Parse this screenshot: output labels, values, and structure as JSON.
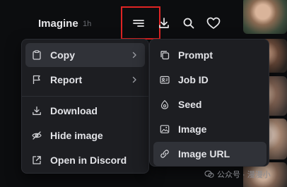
{
  "header": {
    "title": "Imagine",
    "time": "1h",
    "highlight_color": "#e02424"
  },
  "icons": {
    "menu": "menu-lines-icon",
    "download": "download-icon",
    "search": "search-icon",
    "like": "heart-icon"
  },
  "main_menu": {
    "items": [
      {
        "label": "Copy",
        "icon": "clipboard-icon",
        "submenu": true,
        "active": true
      },
      {
        "label": "Report",
        "icon": "flag-icon",
        "submenu": true
      },
      {
        "label": "Download",
        "icon": "download-icon"
      },
      {
        "label": "Hide image",
        "icon": "eye-off-icon"
      },
      {
        "label": "Open in Discord",
        "icon": "external-link-icon"
      }
    ]
  },
  "copy_submenu": {
    "items": [
      {
        "label": "Prompt",
        "icon": "copy-icon"
      },
      {
        "label": "Job ID",
        "icon": "id-card-icon"
      },
      {
        "label": "Seed",
        "icon": "seed-icon"
      },
      {
        "label": "Image",
        "icon": "image-icon"
      },
      {
        "label": "Image URL",
        "icon": "link-icon",
        "active": true
      }
    ]
  },
  "watermark": {
    "text": "公众号 · 漫漫小"
  },
  "colors": {
    "background": "#0c0d0f",
    "menu_bg": "#1d1e22",
    "active_item_bg": "#303238",
    "text": "#e3e4e8"
  }
}
